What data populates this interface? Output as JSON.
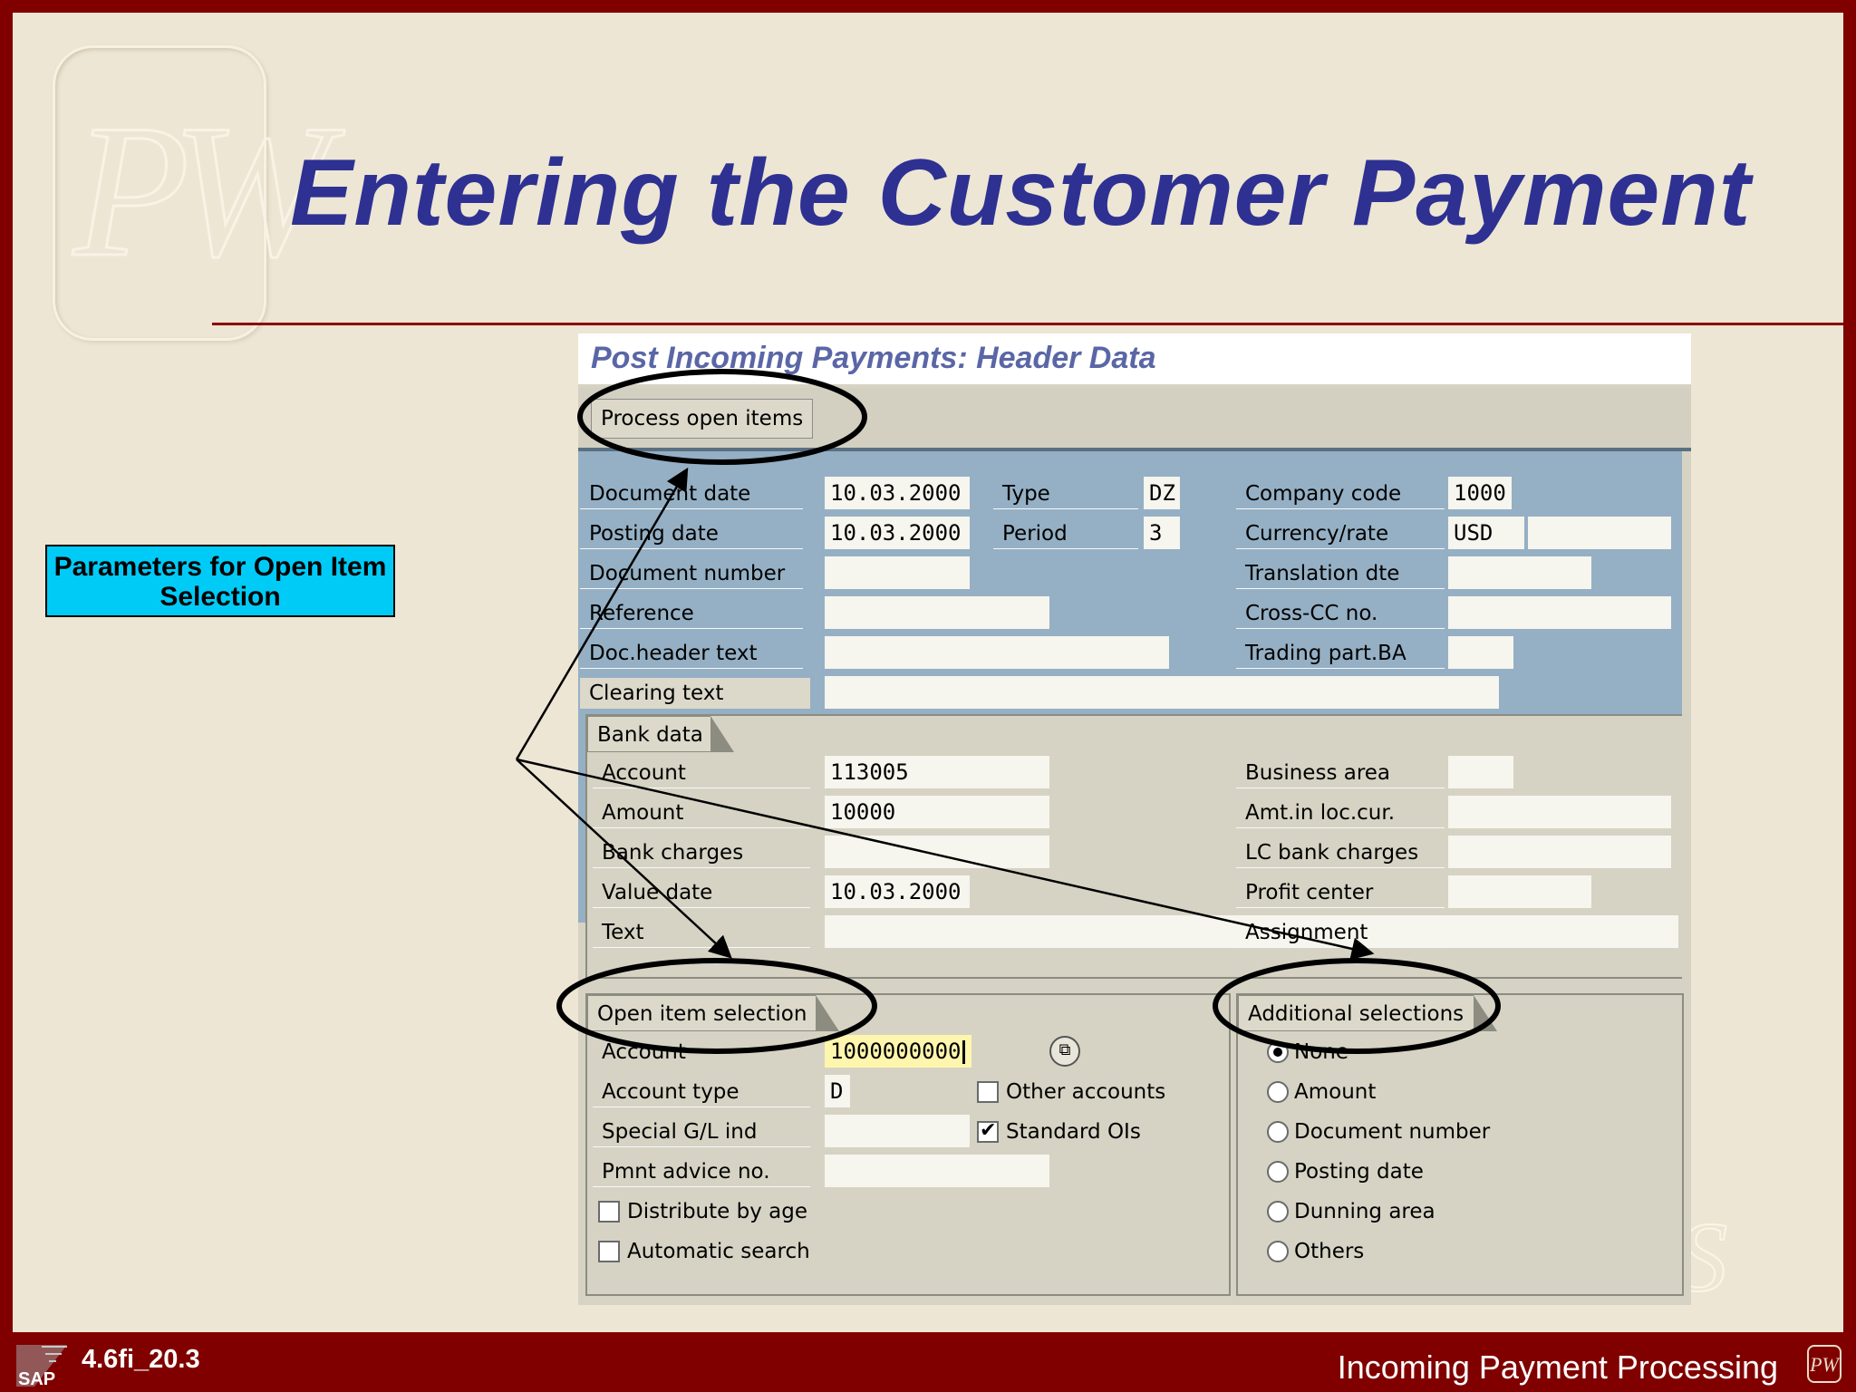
{
  "slide": {
    "title": "Entering the Customer Payment",
    "logo_text": "PW",
    "watermark_text": "RS",
    "callout": "Parameters for Open Item Selection",
    "footer_id": "4.6fi_20.3",
    "footer_sap": "SAP",
    "footer_text": "Incoming Payment Processing",
    "colors": {
      "frame": "#800000",
      "background": "#ede6d4",
      "title": "#2e3192",
      "callout": "#00cbf7"
    }
  },
  "sap": {
    "screen_title": "Post Incoming Payments: Header Data",
    "toolbar": {
      "process_open_items": "Process open items"
    },
    "header": {
      "document_date": {
        "label": "Document date",
        "value": "10.03.2000"
      },
      "posting_date": {
        "label": "Posting date",
        "value": "10.03.2000"
      },
      "document_number": {
        "label": "Document number",
        "value": ""
      },
      "reference": {
        "label": "Reference",
        "value": ""
      },
      "doc_header_text": {
        "label": "Doc.header text",
        "value": ""
      },
      "clearing_text": {
        "label": "Clearing text",
        "value": ""
      },
      "type": {
        "label": "Type",
        "value": "DZ"
      },
      "period": {
        "label": "Period",
        "value": "3"
      },
      "company_code": {
        "label": "Company code",
        "value": "1000"
      },
      "currency_rate": {
        "label": "Currency/rate",
        "value": "USD",
        "rate": ""
      },
      "translation_dte": {
        "label": "Translation dte",
        "value": ""
      },
      "cross_cc_no": {
        "label": "Cross-CC no.",
        "value": ""
      },
      "trading_part_ba": {
        "label": "Trading part.BA",
        "value": ""
      }
    },
    "bank_data": {
      "title": "Bank data",
      "account": {
        "label": "Account",
        "value": "113005"
      },
      "amount": {
        "label": "Amount",
        "value": "10000"
      },
      "bank_charges": {
        "label": "Bank charges",
        "value": ""
      },
      "value_date": {
        "label": "Value date",
        "value": "10.03.2000"
      },
      "text": {
        "label": "Text",
        "value": ""
      },
      "business_area": {
        "label": "Business area",
        "value": ""
      },
      "amt_loc_cur": {
        "label": "Amt.in loc.cur.",
        "value": ""
      },
      "lc_bank_charges": {
        "label": "LC bank charges",
        "value": ""
      },
      "profit_center": {
        "label": "Profit center",
        "value": ""
      },
      "assignment": {
        "label": "Assignment",
        "value": ""
      }
    },
    "open_item_selection": {
      "title": "Open item selection",
      "account": {
        "label": "Account",
        "value": "1000000000"
      },
      "account_type": {
        "label": "Account type",
        "value": "D"
      },
      "special_gl_ind": {
        "label": "Special G/L ind",
        "value": ""
      },
      "pmnt_advice_no": {
        "label": "Pmnt advice no.",
        "value": ""
      },
      "other_accounts": {
        "label": "Other accounts",
        "checked": false
      },
      "standard_ois": {
        "label": "Standard OIs",
        "checked": true
      },
      "distribute_by_age": {
        "label": "Distribute by age",
        "checked": false
      },
      "automatic_search": {
        "label": "Automatic search",
        "checked": false
      }
    },
    "additional_selections": {
      "title": "Additional selections",
      "options": [
        "None",
        "Amount",
        "Document number",
        "Posting date",
        "Dunning area",
        "Others"
      ],
      "selected": "None"
    }
  }
}
